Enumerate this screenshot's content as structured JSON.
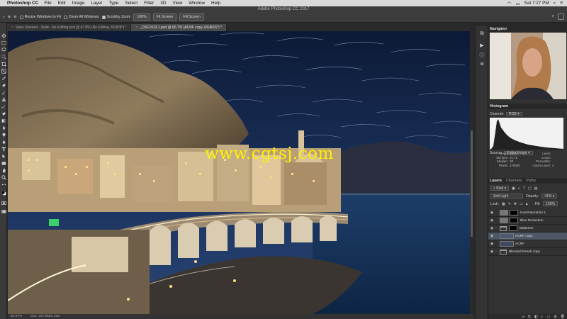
{
  "menubar": {
    "app_name": "Photoshop CC",
    "items": [
      "File",
      "Edit",
      "Image",
      "Layer",
      "Type",
      "Select",
      "Filter",
      "3D",
      "View",
      "Window",
      "Help"
    ],
    "clock": "Sat 7:27 PM"
  },
  "window_title": "Adobe Photoshop CC 2017",
  "options": {
    "resize_windows": "Resize Windows to Fit",
    "zoom_all": "Zoom All Windows",
    "scrubby_zoom": "Scrubby Zoom",
    "zoom_value": "100%",
    "fit_screen": "Fit Screen",
    "fill_screen": "Fill Screen"
  },
  "tabs": [
    {
      "label": "Stars Stacked - Solid - No Editing.psd @ 47.8% (No Editing, RGB/8*) *"
    },
    {
      "label": "_DSF2413-1.psd @ 66.7% (ACRF copy, RGB/16*) *"
    }
  ],
  "watermark": "www.cgtsj.com",
  "status": {
    "zoom": "66.67%",
    "doc": "Doc: 157.9M/2.18G"
  },
  "navigator": {
    "title": "Navigator"
  },
  "histogram": {
    "title": "Histogram",
    "channel_label": "Channel:",
    "channel_value": "RGB",
    "source_label": "Source:",
    "source_value": "Entire Image",
    "stats_left": [
      {
        "label": "Mean:",
        "value": "48.25"
      },
      {
        "label": "Std Dev:",
        "value": "31.71"
      },
      {
        "label": "Median:",
        "value": "38"
      },
      {
        "label": "Pixels:",
        "value": "375000"
      }
    ],
    "stats_right": [
      {
        "label": "Level:",
        "value": ""
      },
      {
        "label": "Count:",
        "value": ""
      },
      {
        "label": "Percentile:",
        "value": ""
      },
      {
        "label": "Cache Level:",
        "value": "4"
      }
    ]
  },
  "layers": {
    "tabs": [
      "Layers",
      "Channels",
      "Paths"
    ],
    "kind": "Kind",
    "blend_mode": "Soft Light",
    "opacity_label": "Opacity:",
    "opacity_value": "41%",
    "lock_label": "Lock:",
    "fill_label": "Fill:",
    "fill_value": "100%",
    "items": [
      {
        "name": "Hue/Saturation 1",
        "type": "adjustment",
        "selected": false
      },
      {
        "name": "Blue Reduction",
        "type": "adjustment",
        "selected": false
      },
      {
        "name": "Midtones",
        "type": "group",
        "selected": false
      },
      {
        "name": "ACRF copy",
        "type": "pixel",
        "selected": true
      },
      {
        "name": "ACRF",
        "type": "pixel",
        "selected": false
      },
      {
        "name": "Blended Result copy",
        "type": "group",
        "selected": false
      }
    ]
  }
}
